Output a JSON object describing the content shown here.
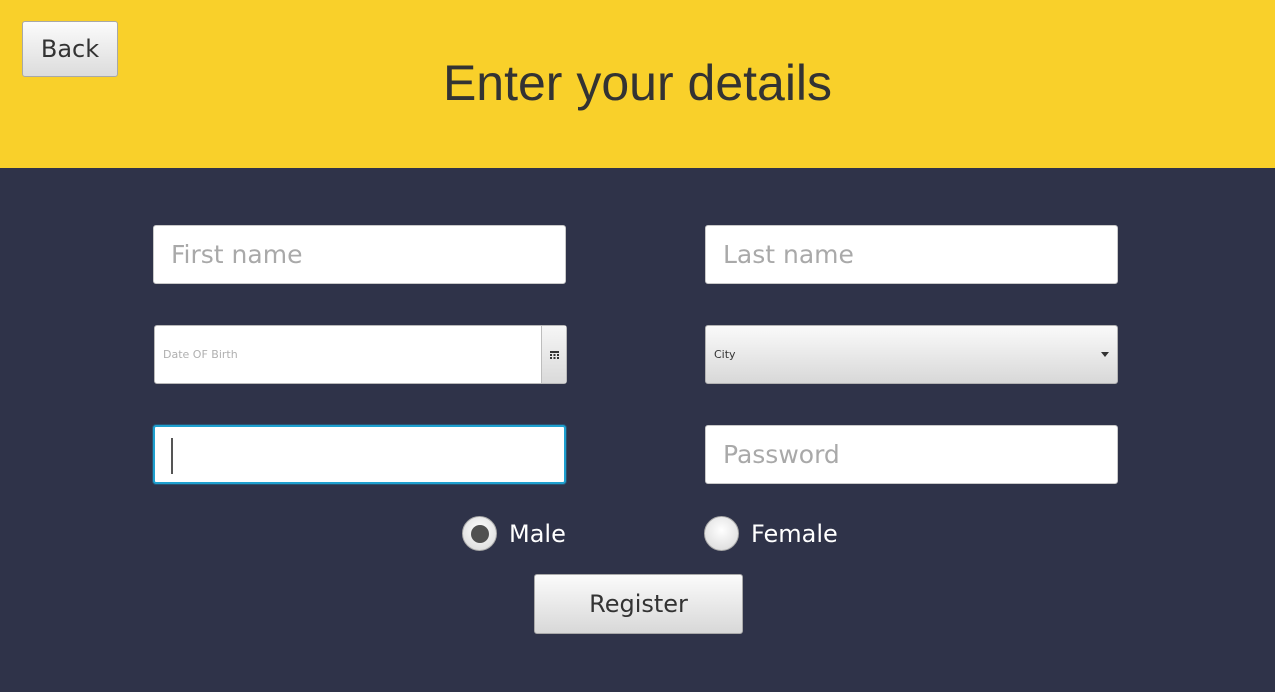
{
  "header": {
    "back_label": "Back",
    "title": "Enter your details",
    "background_color": "#f9d02a"
  },
  "form": {
    "first_name": {
      "value": "",
      "placeholder": "First name"
    },
    "last_name": {
      "value": "",
      "placeholder": "Last name"
    },
    "date_of_birth": {
      "value": "",
      "placeholder": "Date OF Birth",
      "picker_icon": "calendar-icon"
    },
    "city": {
      "selected": "City",
      "dropdown_icon": "caret-down-icon"
    },
    "focused_field": {
      "value": "",
      "placeholder": ""
    },
    "password": {
      "value": "",
      "placeholder": "Password"
    },
    "gender": {
      "options": [
        {
          "label": "Male",
          "selected": true
        },
        {
          "label": "Female",
          "selected": false
        }
      ]
    },
    "register_label": "Register"
  },
  "colors": {
    "background": "#2f3349",
    "focus_border": "#1ea0cf"
  }
}
